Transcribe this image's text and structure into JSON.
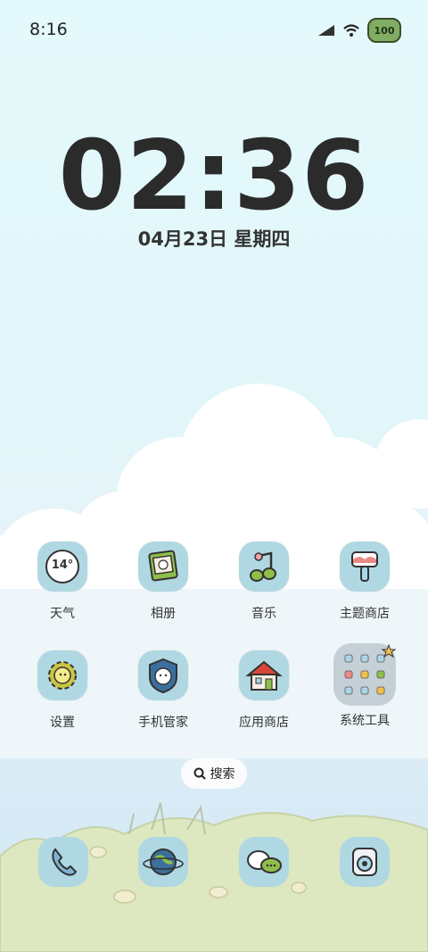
{
  "status_bar": {
    "time": "8:16",
    "battery": "100"
  },
  "lockscreen": {
    "clock": "02:36",
    "date": "04月23日 星期四"
  },
  "apps_row1": [
    {
      "label": "天气",
      "icon": "weather-icon",
      "temp": "14°"
    },
    {
      "label": "相册",
      "icon": "gallery-icon"
    },
    {
      "label": "音乐",
      "icon": "music-icon"
    },
    {
      "label": "主题商店",
      "icon": "theme-store-icon"
    }
  ],
  "apps_row2": [
    {
      "label": "设置",
      "icon": "settings-icon"
    },
    {
      "label": "手机管家",
      "icon": "phone-manager-icon"
    },
    {
      "label": "应用商店",
      "icon": "app-store-icon"
    },
    {
      "label": "系统工具",
      "icon": "system-tools-folder-icon"
    }
  ],
  "search": {
    "label": "搜索"
  },
  "dock": [
    {
      "icon": "phone-icon"
    },
    {
      "icon": "browser-icon"
    },
    {
      "icon": "messages-icon"
    },
    {
      "icon": "camera-icon"
    }
  ],
  "colors": {
    "icon_bg": "#b0d8e2",
    "text": "#333333",
    "grass": "#dde8c0"
  }
}
